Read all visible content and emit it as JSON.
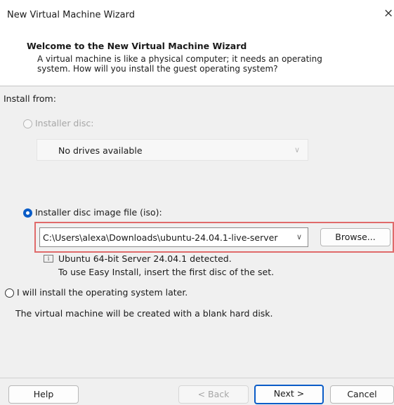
{
  "window": {
    "title": "New Virtual Machine Wizard",
    "close_glyph": "×"
  },
  "header": {
    "title": "Welcome to the New Virtual Machine Wizard",
    "description_line1": "A virtual machine is like a physical computer; it needs an operating",
    "description_line2": "system. How will you install the guest operating system?"
  },
  "install_from": {
    "label": "Install from:",
    "installer_disc": {
      "label": "Installer disc:",
      "selected": false,
      "enabled": false,
      "dropdown_value": "No drives available"
    },
    "iso_image": {
      "label": "Installer disc image file (iso):",
      "selected": true,
      "path": "C:\\Users\\alexa\\Downloads\\ubuntu-24.04.1-live-server",
      "browse_label": "Browse...",
      "info_line1": "Ubuntu 64-bit Server 24.04.1 detected.",
      "info_line2": "To use Easy Install, insert the first disc of the set."
    },
    "install_later": {
      "label": "I will install the operating system later.",
      "selected": false,
      "description": "The virtual machine will be created with a blank hard disk."
    }
  },
  "footer": {
    "help_label": "Help",
    "back_label": "< Back",
    "next_label": "Next >",
    "cancel_label": "Cancel"
  },
  "colors": {
    "accent": "#0a5cc7",
    "highlight": "#e06a6a"
  }
}
